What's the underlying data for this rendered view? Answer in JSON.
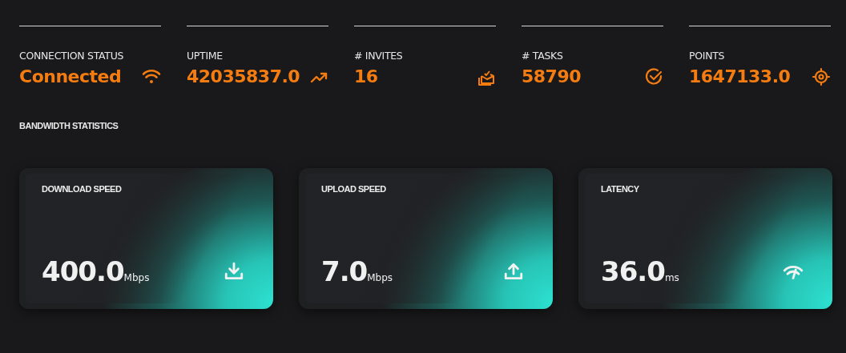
{
  "stats": [
    {
      "label": "CONNECTION STATUS",
      "value": "Connected",
      "kind": "wifi"
    },
    {
      "label": "UPTIME",
      "value": "42035837.0",
      "kind": "trend"
    },
    {
      "label": "# INVITES",
      "value": "16",
      "kind": "invite"
    },
    {
      "label": "# TASKS",
      "value": "58790",
      "kind": "check"
    },
    {
      "label": "POINTS",
      "value": "1647133.0",
      "kind": "target"
    }
  ],
  "section_title": "BANDWIDTH STATISTICS",
  "cards": [
    {
      "title": "DOWNLOAD SPEED",
      "value": "400.0",
      "unit": "Mbps",
      "kind": "download"
    },
    {
      "title": "UPLOAD SPEED",
      "value": "7.0",
      "unit": "Mbps",
      "kind": "upload"
    },
    {
      "title": "LATENCY",
      "value": "36.0",
      "unit": "ms",
      "kind": "gauge"
    }
  ]
}
